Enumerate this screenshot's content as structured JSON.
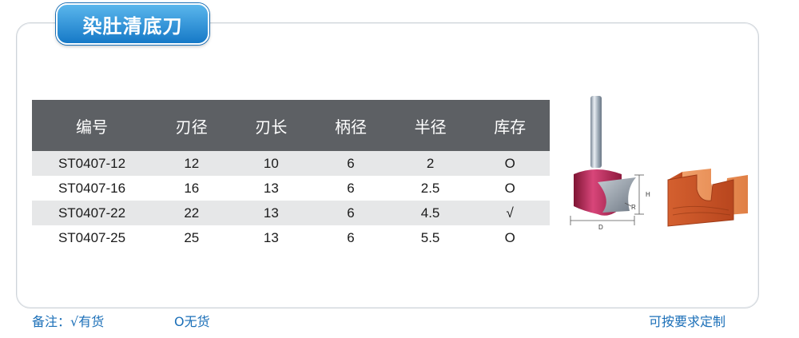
{
  "title": "染肚清底刀",
  "table": {
    "headers": [
      "编号",
      "刃径",
      "刃长",
      "柄径",
      "半径",
      "库存"
    ],
    "rows": [
      [
        "ST0407-12",
        "12",
        "10",
        "6",
        "2",
        "O"
      ],
      [
        "ST0407-16",
        "16",
        "13",
        "6",
        "2.5",
        "O"
      ],
      [
        "ST0407-22",
        "22",
        "13",
        "6",
        "4.5",
        "√"
      ],
      [
        "ST0407-25",
        "25",
        "13",
        "6",
        "5.5",
        "O"
      ]
    ]
  },
  "diagram_labels": {
    "h": "H",
    "r": "R",
    "d": "D"
  },
  "footer": {
    "note_prefix": "备注：√有货",
    "note_none": "O无货",
    "custom": "可按要求定制"
  },
  "colors": {
    "accent": "#1b6fb8",
    "header_bg": "#5d6064",
    "row_shade": "#e6e7e8",
    "cutter": "#b5284f",
    "wood": "#d9693a"
  }
}
